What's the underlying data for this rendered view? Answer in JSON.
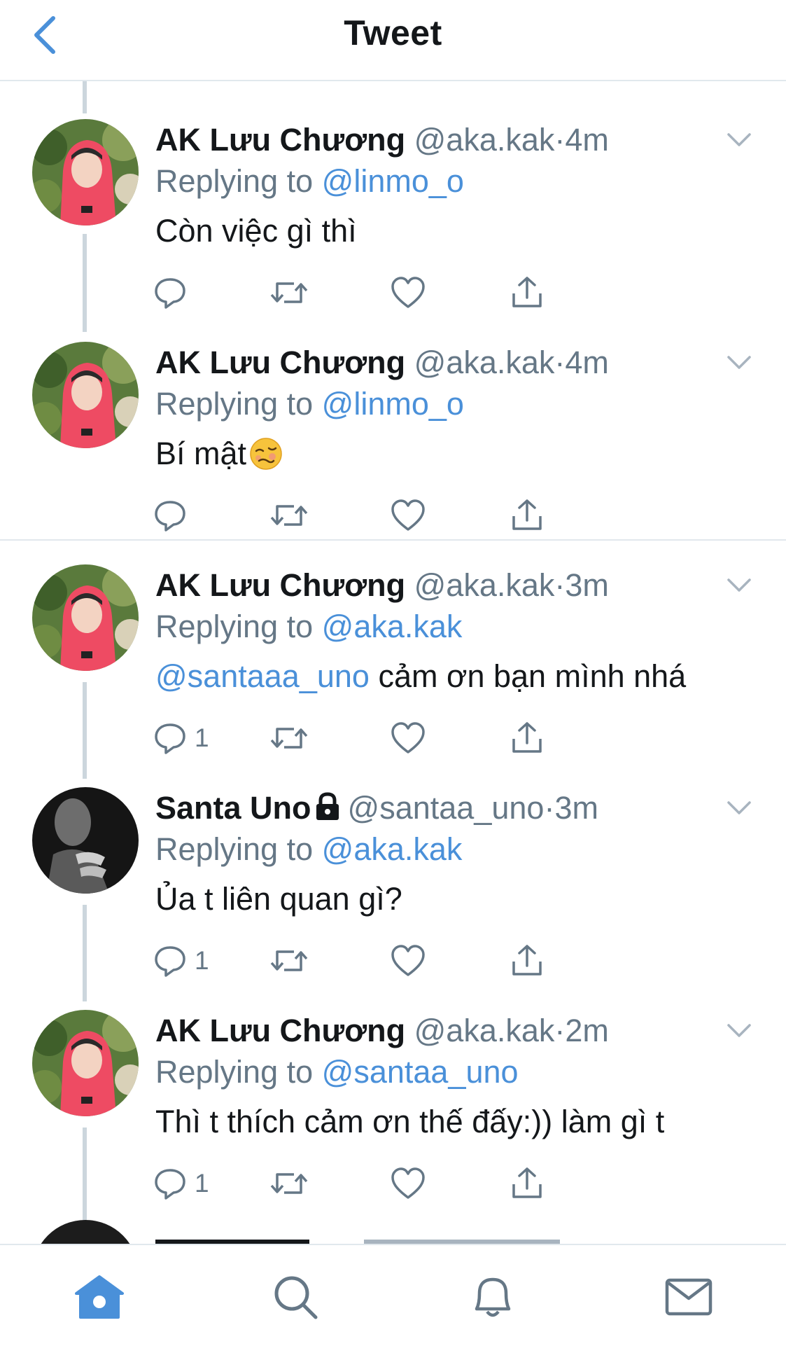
{
  "header": {
    "title": "Tweet"
  },
  "colors": {
    "accent": "#4a90d9",
    "secondary": "#657786",
    "text": "#14171a"
  },
  "tweets": [
    {
      "name": "AK Lưu Chương",
      "handle": "@aka.kak",
      "dot": "·",
      "time": "4m",
      "reply_prefix": "Replying to",
      "reply_to": "@linmo_o",
      "text_link": "",
      "text": "Còn việc gì thì",
      "emoji": "",
      "reply_count": "",
      "locked": false,
      "avatar": "pink-hoodie"
    },
    {
      "name": "AK Lưu Chương",
      "handle": "@aka.kak",
      "dot": "·",
      "time": "4m",
      "reply_prefix": "Replying to",
      "reply_to": "@linmo_o",
      "text_link": "",
      "text": "Bí mật",
      "emoji": "woozy-face",
      "reply_count": "",
      "locked": false,
      "avatar": "pink-hoodie"
    },
    {
      "name": "AK Lưu Chương",
      "handle": "@aka.kak",
      "dot": "·",
      "time": "3m",
      "reply_prefix": "Replying to",
      "reply_to": "@aka.kak",
      "text_link": "@santaaa_uno",
      "text": "cảm ơn bạn mình nhá",
      "emoji": "",
      "reply_count": "1",
      "locked": false,
      "avatar": "pink-hoodie"
    },
    {
      "name": "Santa Uno",
      "handle": "@santaa_uno",
      "dot": "·",
      "time": "3m",
      "reply_prefix": "Replying to",
      "reply_to": "@aka.kak",
      "text_link": "",
      "text": "Ủa t liên quan gì?",
      "emoji": "",
      "reply_count": "1",
      "locked": true,
      "avatar": "dark-portrait"
    },
    {
      "name": "AK Lưu Chương",
      "handle": "@aka.kak",
      "dot": "·",
      "time": "2m",
      "reply_prefix": "Replying to",
      "reply_to": "@santaa_uno",
      "text_link": "",
      "text": "Thì t thích cảm ơn thế đấy:)) làm gì t",
      "emoji": "",
      "reply_count": "1",
      "locked": false,
      "avatar": "pink-hoodie"
    }
  ],
  "tabbar": {
    "items": [
      "home-icon",
      "search-icon",
      "notifications-icon",
      "messages-icon"
    ],
    "active": "home-icon"
  }
}
